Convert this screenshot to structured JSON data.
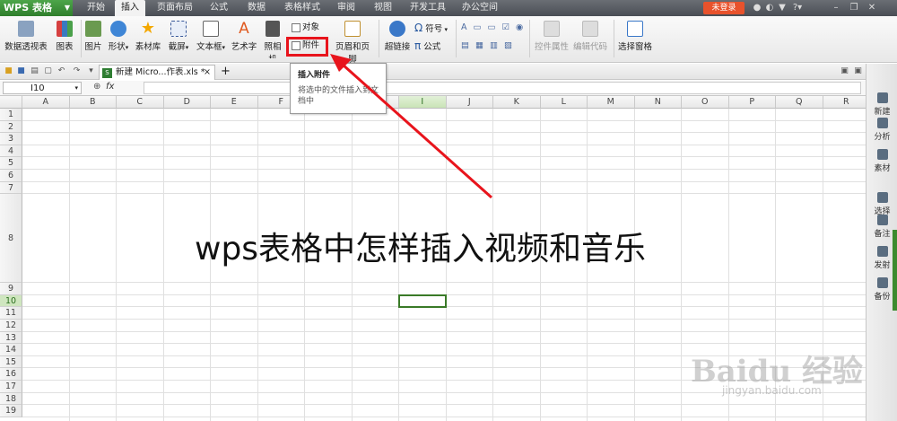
{
  "app": {
    "name": "WPS 表格",
    "login_label": "未登录"
  },
  "menu_tabs": [
    "开始",
    "插入",
    "页面布局",
    "公式",
    "数据",
    "表格样式",
    "审阅",
    "视图",
    "开发工具",
    "办公空间"
  ],
  "active_tab": "插入",
  "ribbon": {
    "pivot": "数据透视表",
    "chart": "图表",
    "picture": "图片",
    "shape": "形状",
    "material": "素材库",
    "screenshot": "截屏",
    "textbox": "文本框",
    "wordart": "艺术字",
    "camera": "照相机",
    "object": "对象",
    "attachment": "附件",
    "header_footer": "页眉和页脚",
    "hyperlink": "超链接",
    "symbol": "符号",
    "formula": "公式",
    "control_props": "控件属性",
    "edit_code": "编辑代码",
    "select_pane": "选择窗格"
  },
  "tooltip": {
    "title": "插入附件",
    "desc": "将选中的文件插入到文档中"
  },
  "doc_tab": {
    "label": "新建 Micro...作表.xls *",
    "add": "+"
  },
  "formula_bar": {
    "cell_ref": "I10",
    "fx": "fx",
    "value": ""
  },
  "columns": [
    "A",
    "B",
    "C",
    "D",
    "E",
    "F",
    "G",
    "H",
    "I",
    "J",
    "K",
    "L",
    "M",
    "N",
    "O",
    "P",
    "Q",
    "R"
  ],
  "selected_column": "I",
  "rows": [
    "1",
    "2",
    "3",
    "4",
    "5",
    "6",
    "7",
    "8",
    "9",
    "10",
    "11",
    "12",
    "13",
    "14",
    "15",
    "16",
    "17",
    "18",
    "19"
  ],
  "selected_row": "10",
  "caption": "wps表格中怎样插入视频和音乐",
  "right_panel": [
    "新建",
    "分析",
    "素材",
    "选择",
    "备注",
    "发射",
    "备份"
  ],
  "watermark": {
    "main": "Baidu 经验",
    "sub": "jingyan.baidu.com"
  },
  "colors": {
    "accent_green": "#3a7a28",
    "highlight_red": "#e8141c",
    "login": "#e8522c"
  }
}
